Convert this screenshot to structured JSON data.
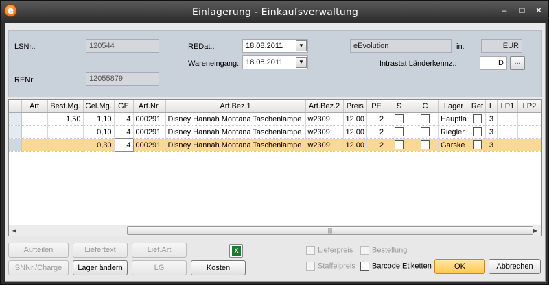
{
  "window": {
    "title": "Einlagerung - Einkaufsverwaltung",
    "icon": "e",
    "minimize": "–",
    "maximize": "□",
    "close": "✕"
  },
  "header": {
    "lsnr_label": "LSNr.:",
    "lsnr_value": "120544",
    "renr_label": "RENr:",
    "renr_value": "12055879",
    "redat_label": "REDat.:",
    "redat_value": "18.08.2011",
    "wareneingang_label": "Wareneingang:",
    "wareneingang_value": "18.08.2011",
    "company_value": "eEvolution",
    "in_label": "in:",
    "currency_value": "EUR",
    "intrastat_label": "Intrastat Länderkennz.:",
    "intrastat_value": "D",
    "ellipsis_label": "..."
  },
  "grid": {
    "columns": [
      "",
      "Art",
      "Best.Mg.",
      "Gel.Mg.",
      "GE",
      "Art.Nr.",
      "Art.Bez.1",
      "Art.Bez.2",
      "Preis",
      "PE",
      "S",
      "C",
      "Lager",
      "Ret",
      "L",
      "LP1",
      "LP2"
    ],
    "rows": [
      {
        "art": "",
        "best": "1,50",
        "gel": "1,10",
        "ge": "4",
        "artnr": "000291",
        "bez1": "Disney Hannah Montana Taschenlampe",
        "bez2": "w2309;",
        "preis": "12,00",
        "pe": "2",
        "s": false,
        "c": false,
        "lager": "Hauptla",
        "ret": false,
        "l": "3",
        "lp1": "",
        "lp2": ""
      },
      {
        "art": "",
        "best": "",
        "gel": "0,10",
        "ge": "4",
        "artnr": "000291",
        "bez1": "Disney Hannah Montana Taschenlampe",
        "bez2": "w2309;",
        "preis": "12,00",
        "pe": "2",
        "s": false,
        "c": false,
        "lager": "Riegler",
        "ret": false,
        "l": "3",
        "lp1": "",
        "lp2": ""
      },
      {
        "art": "",
        "best": "",
        "gel": "0,30",
        "ge": "4",
        "artnr": "000291",
        "bez1": "Disney Hannah Montana Taschenlampe",
        "bez2": "w2309;",
        "preis": "12,00",
        "pe": "2",
        "s": false,
        "c": false,
        "lager": "Garske",
        "ret": false,
        "l": "3",
        "lp1": "",
        "lp2": ""
      }
    ],
    "selected_row": 2,
    "scroll_left": "◀",
    "scroll_right": "▶",
    "scroll_grip": "|||"
  },
  "buttons": {
    "aufteilen": "Aufteilen",
    "liefertext": "Liefertext",
    "liefart": "Lief.Art",
    "snnr": "SNNr./Charge",
    "lager_aendern": "Lager ändern",
    "lg": "LG",
    "kosten": "Kosten",
    "ok": "OK",
    "abbrechen": "Abbrechen"
  },
  "checkboxes": {
    "lieferpreis": "Lieferpreis",
    "bestellung": "Bestellung",
    "staffelpreis": "Staffelpreis",
    "barcode": "Barcode Etiketten"
  },
  "colors": {
    "highlight_row": "#fbd994",
    "header_panel": "#c9d1da",
    "ok_button": "#ffc64a"
  }
}
